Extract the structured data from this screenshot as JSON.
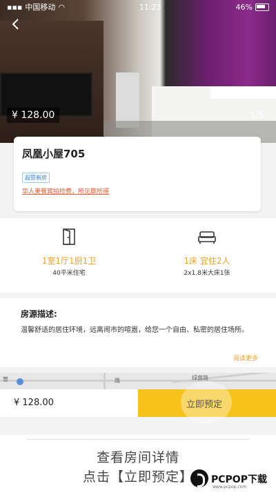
{
  "status_bar": {
    "carrier": "中国移动",
    "time": "11:23",
    "battery": "46%"
  },
  "listing": {
    "price": "¥ 128.00",
    "photo_index": "1/5",
    "title": "凤凰小屋705",
    "badge": "超赞新房",
    "notice": "华人美餐宾拍捡费，所见即所得"
  },
  "specs": [
    {
      "icon": "door-icon",
      "main": "1室1厅1厨1卫",
      "sub": "40平米住宅"
    },
    {
      "icon": "bed-icon",
      "main": "1床 宜住2人",
      "sub": "2x1.8米大床1张"
    }
  ],
  "description": {
    "title": "房源描述:",
    "text": "温馨舒适的居住环境，远离闹市的喧嚣，给您一个自由、私密的居住场所。",
    "read_more": "阅读更多"
  },
  "map": {
    "label_a": "管",
    "label_b": "路",
    "label_c": "绿茵路"
  },
  "bottom_bar": {
    "price": "¥ 128.00",
    "book_label": "立即预定"
  },
  "caption": {
    "line1": "查看房间详情",
    "line2": "点击【立即预定】"
  },
  "watermark": {
    "brand": "PCPOP下载",
    "sub": "www.pcpop.com"
  },
  "colors": {
    "accent": "#f7c21b",
    "orange": "#f0a12a",
    "link": "#e65a2c",
    "badge": "#2f7fd6"
  }
}
